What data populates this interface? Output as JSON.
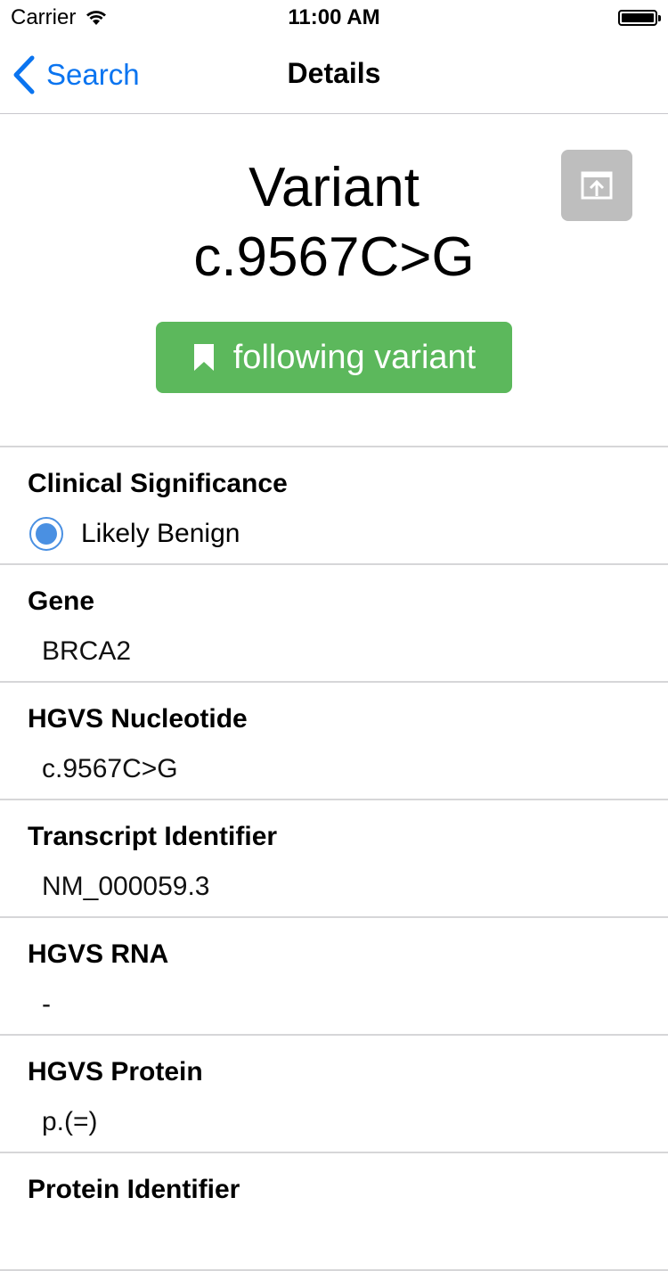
{
  "status_bar": {
    "carrier": "Carrier",
    "time": "11:00 AM"
  },
  "nav": {
    "back_label": "Search",
    "title": "Details"
  },
  "header": {
    "title_line1": "Variant",
    "title_line2": "c.9567C>G",
    "follow_label": "following variant",
    "follow_color": "#5cb85c"
  },
  "sections": [
    {
      "label": "Clinical Significance",
      "value": "Likely Benign"
    },
    {
      "label": "Gene",
      "value": "BRCA2"
    },
    {
      "label": "HGVS Nucleotide",
      "value": "c.9567C>G"
    },
    {
      "label": "Transcript Identifier",
      "value": "NM_000059.3"
    },
    {
      "label": "HGVS RNA",
      "value": "-"
    },
    {
      "label": "HGVS Protein",
      "value": "p.(=)"
    },
    {
      "label": "Protein Identifier",
      "value": ""
    }
  ]
}
